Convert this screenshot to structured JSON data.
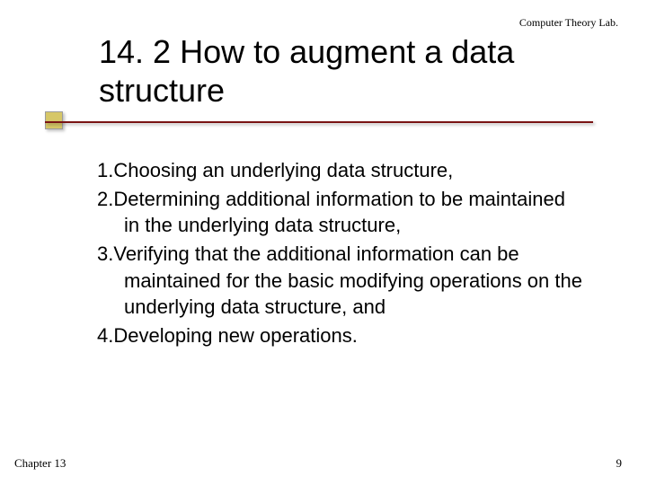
{
  "header": {
    "lab": "Computer Theory Lab."
  },
  "title": "14. 2 How to augment a data structure",
  "list": {
    "items": [
      {
        "num": "1.",
        "text": "Choosing an underlying data structure,"
      },
      {
        "num": "2.",
        "text": "Determining additional information to  be maintained in the underlying data structure,"
      },
      {
        "num": "3.",
        "text": "Verifying that the additional information can be maintained for the basic modifying operations on the underlying data structure, and"
      },
      {
        "num": "4.",
        "text": "Developing new operations."
      }
    ]
  },
  "footer": {
    "chapter": "Chapter 13",
    "page": "9"
  }
}
